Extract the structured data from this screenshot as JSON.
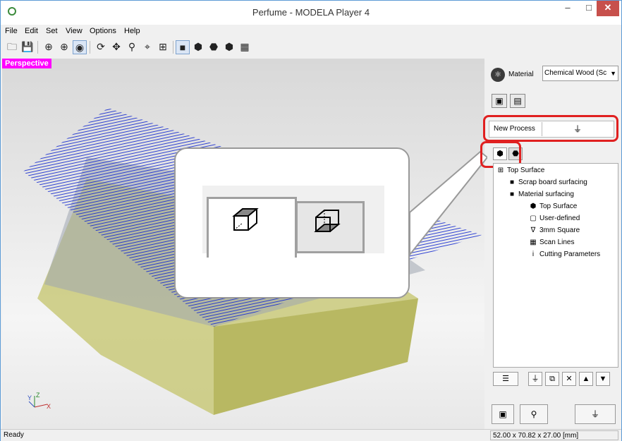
{
  "window": {
    "title": "Perfume - MODELA Player 4",
    "minimize_icon": "minimize-icon",
    "maximize_icon": "maximize-icon",
    "close_icon": "close-icon"
  },
  "menubar": {
    "items": [
      "File",
      "Edit",
      "Set",
      "View",
      "Options",
      "Help"
    ]
  },
  "toolbar": {
    "icons": [
      "new-icon",
      "save-icon",
      "view-a-icon",
      "view-b-icon",
      "view-c-icon",
      "rotate-icon",
      "move-icon",
      "zoom-icon",
      "fit-icon",
      "zoom-window-icon",
      "render-solid-icon",
      "render-shade-icon",
      "render-wire-icon",
      "render-hidden-icon",
      "grid-icon"
    ]
  },
  "viewport": {
    "label": "Perspective",
    "axis_y": "Y",
    "axis_z": "Z",
    "axis_x": "X"
  },
  "right_panel": {
    "material_label": "Material",
    "material_value": "Chemical Wood (Sc",
    "new_process_label": "New Process",
    "tree": [
      {
        "label": "Top Surface",
        "level": 0
      },
      {
        "label": "Scrap board surfacing",
        "level": 1
      },
      {
        "label": "Material surfacing",
        "level": 1
      },
      {
        "label": "Top Surface",
        "level": 2
      },
      {
        "label": "User-defined",
        "level": 2
      },
      {
        "label": "3mm Square",
        "level": 2
      },
      {
        "label": "Scan Lines",
        "level": 2
      },
      {
        "label": "Cutting Parameters",
        "level": 2
      }
    ]
  },
  "status": {
    "left": "Ready",
    "right": "52.00 x 70.82 x 27.00 [mm]"
  },
  "colors": {
    "highlight_red": "#e02020",
    "perspective_label": "#ff00ff",
    "toolpath": "#1a2fd0",
    "material_block": "#bdbd6a"
  }
}
